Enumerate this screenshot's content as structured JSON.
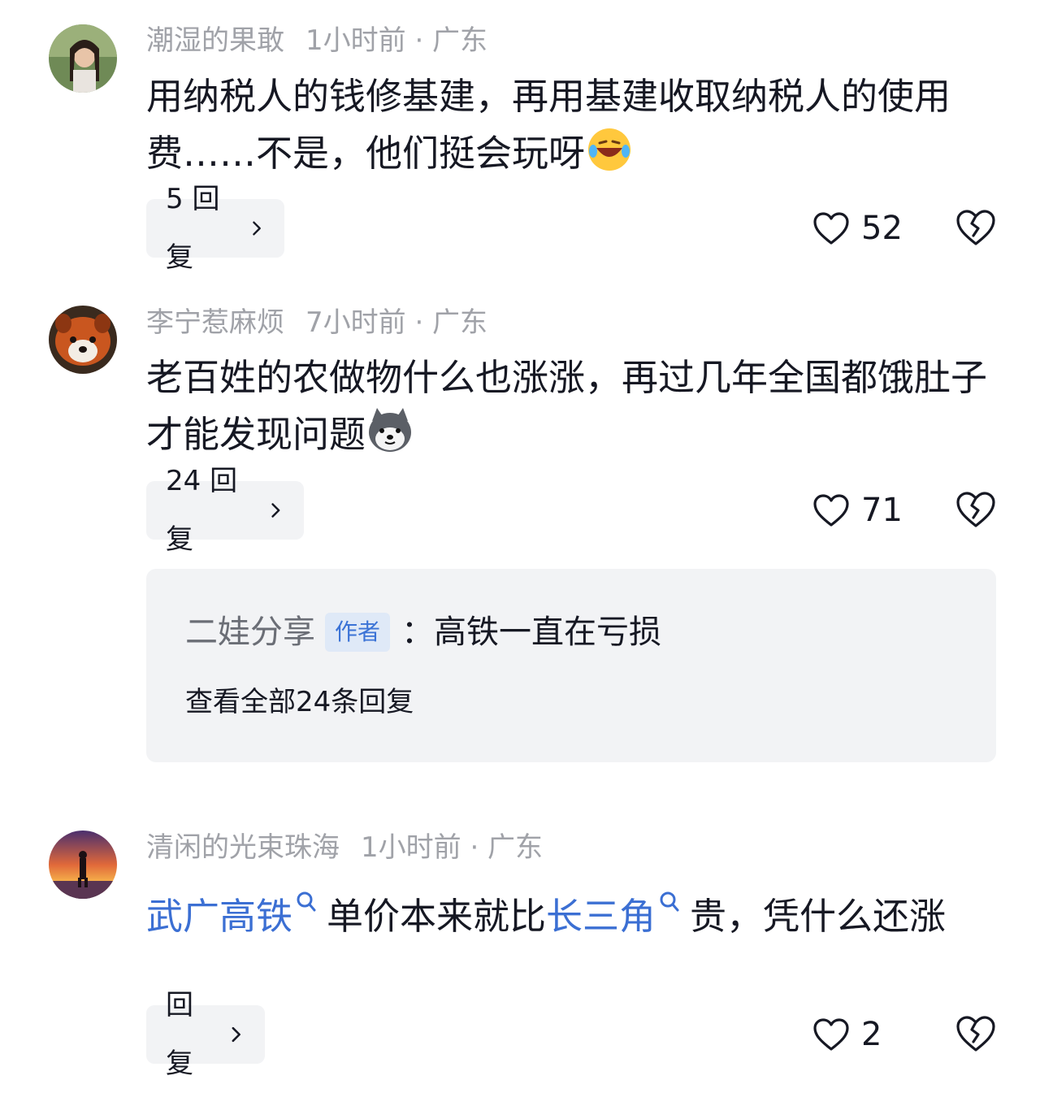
{
  "comments": [
    {
      "username": "潮湿的果敢",
      "time": "1小时前 · 广东",
      "text": "用纳税人的钱修基建，再用基建收取纳税人的使用费……不是，他们挺会玩呀",
      "emoji": "rolling-laughing-emoji",
      "reply_label": "5 回复",
      "likes": "52"
    },
    {
      "username": "李宁惹麻烦",
      "time": "7小时前 · 广东",
      "text": "老百姓的农做物什么也涨涨，再过几年全国都饿肚子才能发现问题",
      "emoji": "husky-dog-emoji",
      "reply_label": "24 回复",
      "likes": "71",
      "sub_reply": {
        "name": "二娃分享",
        "tag": "作者",
        "separator": "：",
        "text": "高铁一直在亏损",
        "view_all": "查看全部24条回复"
      }
    },
    {
      "username": "清闲的光束珠海",
      "time": "1小时前 · 广东",
      "text_parts": [
        {
          "text": "武广高铁",
          "link": true
        },
        {
          "text": "单价本来就比",
          "link": false
        },
        {
          "text": "长三角",
          "link": true
        },
        {
          "text": "贵，凭什么还涨",
          "link": false
        }
      ],
      "reply_label": "回复",
      "likes": "2"
    }
  ],
  "colors": {
    "link": "#3b6fd3",
    "meta": "#a0a2a8",
    "panel": "#f2f3f5",
    "tag_bg": "#dfe9f7",
    "tag_text": "#3b73d6"
  },
  "icons": [
    "heart-icon",
    "broken-heart-icon",
    "chevron-right-icon",
    "search-icon"
  ]
}
